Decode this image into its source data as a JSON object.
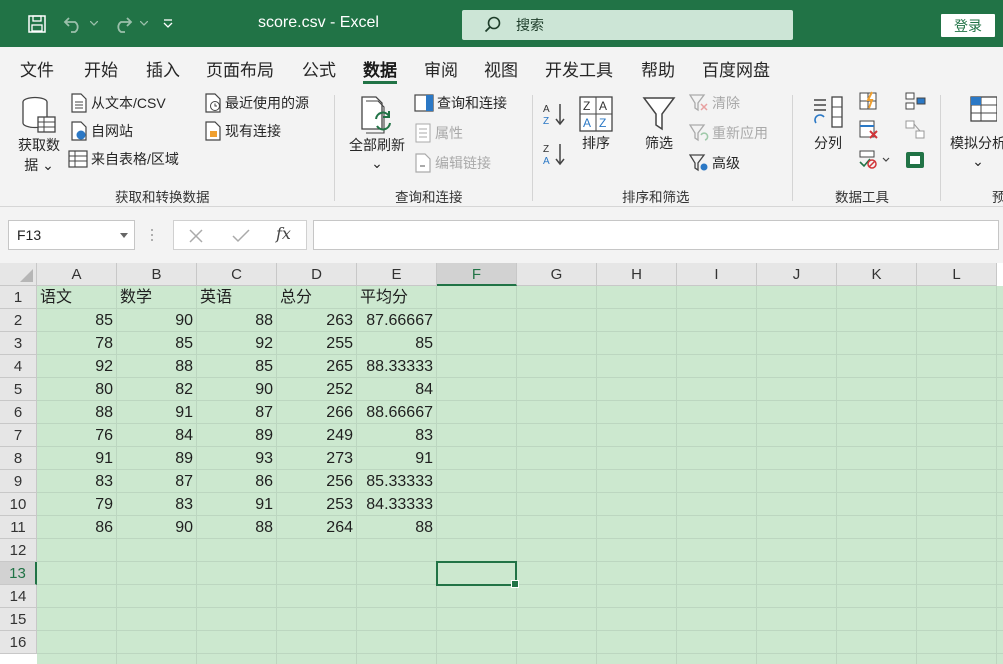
{
  "window": {
    "title": "score.csv  -  Excel",
    "search_placeholder": "搜索",
    "login": "登录"
  },
  "menu": {
    "tabs": [
      "文件",
      "开始",
      "插入",
      "页面布局",
      "公式",
      "数据",
      "审阅",
      "视图",
      "开发工具",
      "帮助",
      "百度网盘"
    ],
    "active": "数据"
  },
  "ribbon": {
    "get_transform": {
      "get_data": "获取数",
      "get_data_2": "据",
      "from_text": "从文本/CSV",
      "from_web": "自网站",
      "from_table": "来自表格/区域",
      "recent_sources": "最近使用的源",
      "existing_connections": "现有连接",
      "label": "获取和转换数据"
    },
    "queries": {
      "refresh_all": "全部刷新",
      "queries_connections": "查询和连接",
      "properties": "属性",
      "edit_links": "编辑链接",
      "label": "查询和连接"
    },
    "sort_filter": {
      "sort": "排序",
      "filter": "筛选",
      "clear": "清除",
      "reapply": "重新应用",
      "advanced": "高级",
      "label": "排序和筛选"
    },
    "data_tools": {
      "text_to_columns": "分列",
      "label": "数据工具"
    },
    "forecast": {
      "what_if": "模拟分析",
      "label": "预"
    }
  },
  "formula_bar": {
    "name_box": "F13",
    "formula": "",
    "fx": "fx"
  },
  "sheet": {
    "columns": [
      "A",
      "B",
      "C",
      "D",
      "E",
      "F",
      "G",
      "H",
      "I",
      "J",
      "K",
      "L"
    ],
    "rows": [
      "1",
      "2",
      "3",
      "4",
      "5",
      "6",
      "7",
      "8",
      "9",
      "10",
      "11",
      "12",
      "13",
      "14",
      "15",
      "16"
    ],
    "selected_cell": "F13",
    "header_row": [
      "语文",
      "数学",
      "英语",
      "总分",
      "平均分"
    ],
    "data": [
      [
        "85",
        "90",
        "88",
        "263",
        "87.66667"
      ],
      [
        "78",
        "85",
        "92",
        "255",
        "85"
      ],
      [
        "92",
        "88",
        "85",
        "265",
        "88.33333"
      ],
      [
        "80",
        "82",
        "90",
        "252",
        "84"
      ],
      [
        "88",
        "91",
        "87",
        "266",
        "88.66667"
      ],
      [
        "76",
        "84",
        "89",
        "249",
        "83"
      ],
      [
        "91",
        "89",
        "93",
        "273",
        "91"
      ],
      [
        "83",
        "87",
        "86",
        "256",
        "85.33333"
      ],
      [
        "79",
        "83",
        "91",
        "253",
        "84.33333"
      ],
      [
        "86",
        "90",
        "88",
        "264",
        "88"
      ]
    ]
  },
  "colors": {
    "accent": "#217346",
    "cell_fill": "#cce8cf",
    "ribbon_bg": "#f3f3f3"
  }
}
